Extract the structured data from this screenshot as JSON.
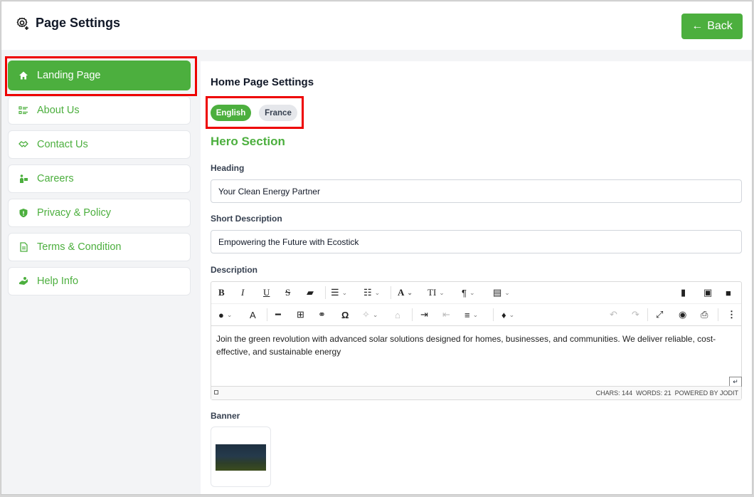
{
  "header": {
    "title": "Page Settings",
    "back_label": "Back"
  },
  "sidebar": {
    "items": [
      {
        "label": "Landing Page",
        "icon": "home-icon",
        "active": true
      },
      {
        "label": "About Us",
        "icon": "list-icon",
        "active": false
      },
      {
        "label": "Contact Us",
        "icon": "handshake-icon",
        "active": false
      },
      {
        "label": "Careers",
        "icon": "briefcase-person-icon",
        "active": false
      },
      {
        "label": "Privacy & Policy",
        "icon": "shield-icon",
        "active": false
      },
      {
        "label": "Terms & Condition",
        "icon": "document-icon",
        "active": false
      },
      {
        "label": "Help Info",
        "icon": "help-hand-icon",
        "active": false
      }
    ]
  },
  "main": {
    "section_title": "Home Page Settings",
    "languages": [
      {
        "label": "English",
        "selected": true
      },
      {
        "label": "France",
        "selected": false
      }
    ],
    "hero_title": "Hero Section",
    "heading_label": "Heading",
    "heading_value": "Your Clean Energy Partner",
    "short_desc_label": "Short Description",
    "short_desc_value": "Empowering the Future with Ecostick",
    "description_label": "Description",
    "description_text": "Join the green revolution with advanced solar solutions designed for homes, businesses, and communities. We deliver reliable, cost-effective, and sustainable energy",
    "editor_status": {
      "chars": "CHARS: 144",
      "words": "WORDS: 21",
      "powered": "POWERED BY JODIT"
    },
    "banner_label": "Banner"
  },
  "colors": {
    "accent": "#4caf3e",
    "highlight": "#ee0000"
  }
}
